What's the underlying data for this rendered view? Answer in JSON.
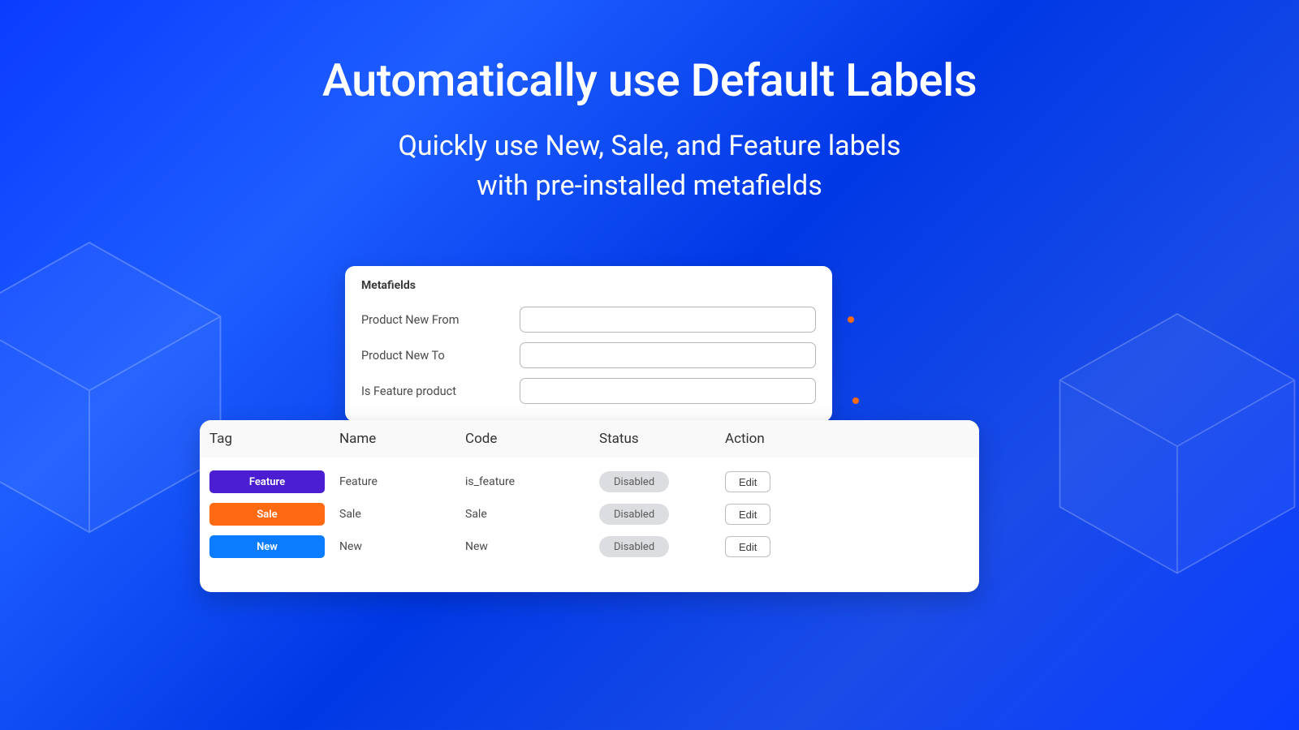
{
  "title": "Automatically use Default Labels",
  "subtitle_line1": "Quickly use New, Sale, and Feature labels",
  "subtitle_line2": "with pre-installed metafields",
  "metafields_card": {
    "title": "Metafields",
    "rows": [
      {
        "label": "Product New From",
        "value": ""
      },
      {
        "label": "Product New To",
        "value": ""
      },
      {
        "label": "Is Feature product",
        "value": ""
      }
    ]
  },
  "table": {
    "columns": {
      "tag": "Tag",
      "name": "Name",
      "code": "Code",
      "status": "Status",
      "action": "Action"
    },
    "rows": [
      {
        "tag": "Feature",
        "tag_color": "#4b1fd1",
        "name": "Feature",
        "code": "is_feature",
        "status": "Disabled",
        "action": "Edit"
      },
      {
        "tag": "Sale",
        "tag_color": "#ff6a13",
        "name": "Sale",
        "code": "Sale",
        "status": "Disabled",
        "action": "Edit"
      },
      {
        "tag": "New",
        "tag_color": "#0b7cff",
        "name": "New",
        "code": "New",
        "status": "Disabled",
        "action": "Edit"
      }
    ]
  }
}
